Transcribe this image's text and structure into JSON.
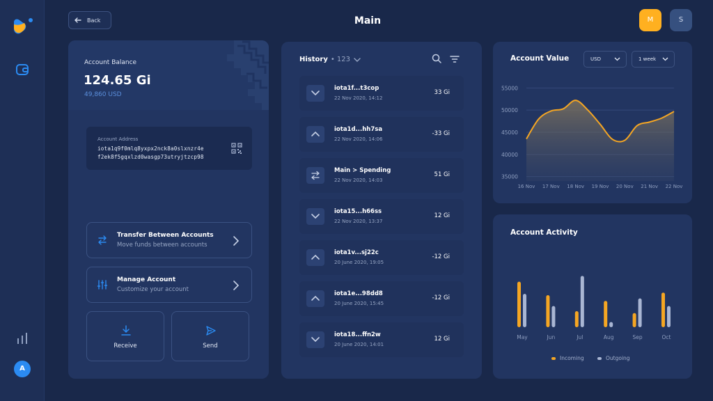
{
  "header": {
    "back_label": "Back",
    "title": "Main",
    "profiles": [
      "M",
      "S"
    ]
  },
  "sidebar": {
    "items": [
      {
        "icon": "wallet-icon"
      },
      {
        "icon": "chart-icon"
      }
    ],
    "avatar": "A"
  },
  "account": {
    "balance_label": "Account Balance",
    "balance": "124.65 Gi",
    "fiat": "49,860 USD",
    "address_label": "Account Address",
    "address_line1": "iota1q9f0mlq8yxpx2nck8a0slxnzr4e",
    "address_line2": "f2ek8f5gqxlzd0wasgp73utryjtzcp98",
    "actions": [
      {
        "title": "Transfer Between Accounts",
        "subtitle": "Move funds between accounts",
        "icon": "transfer-icon"
      },
      {
        "title": "Manage Account",
        "subtitle": "Customize your account",
        "icon": "sliders-icon"
      }
    ],
    "receive_label": "Receive",
    "send_label": "Send"
  },
  "history": {
    "title": "History",
    "count": "• 123",
    "items": [
      {
        "name": "iota1f...t3cop",
        "date": "22 Nov 2020, 14:12",
        "amount": "33 Gi",
        "icon": "chevron-down-icon"
      },
      {
        "name": "iota1d...hh7sa",
        "date": "22 Nov 2020, 14:06",
        "amount": "-33 Gi",
        "icon": "chevron-up-icon"
      },
      {
        "name": "Main > Spending",
        "date": "22 Nov 2020, 14:03",
        "amount": "51 Gi",
        "icon": "transfer-icon"
      },
      {
        "name": "iota15...h66ss",
        "date": "22 Nov 2020, 13:37",
        "amount": "12 Gi",
        "icon": "chevron-down-icon"
      },
      {
        "name": "iota1v...sj22c",
        "date": "20 June 2020, 19:05",
        "amount": "-12 Gi",
        "icon": "chevron-up-icon"
      },
      {
        "name": "iota1e...98dd8",
        "date": "20 June 2020, 15:45",
        "amount": "-12 Gi",
        "icon": "chevron-up-icon"
      },
      {
        "name": "iota18...ffn2w",
        "date": "20 June 2020, 14:01",
        "amount": "12 Gi",
        "icon": "chevron-down-icon"
      }
    ]
  },
  "value": {
    "title": "Account Value",
    "currency": "USD",
    "range": "1 week"
  },
  "activity": {
    "title": "Account Activity",
    "legend_incoming": "Incoming",
    "legend_outgoing": "Outgoing"
  },
  "colors": {
    "accent": "#f5a623",
    "blue": "#2b8bf2",
    "outgoing": "#a9b6d3"
  },
  "chart_data": [
    {
      "type": "area",
      "title": "Account Value",
      "categories": [
        "16 Nov",
        "17 Nov",
        "18 Nov",
        "19 Nov",
        "20 Nov",
        "21 Nov",
        "22 Nov"
      ],
      "x": [
        0,
        0.5,
        1,
        1.5,
        2,
        2.5,
        3,
        3.5,
        4,
        4.5,
        5,
        5.5,
        6
      ],
      "values": [
        43500,
        48000,
        49800,
        50300,
        52200,
        50000,
        46800,
        43400,
        43200,
        46500,
        47300,
        48200,
        49700
      ],
      "yticks": [
        35000,
        40000,
        45000,
        50000,
        55000
      ],
      "ylim": [
        34000,
        56000
      ]
    },
    {
      "type": "bar",
      "title": "Account Activity",
      "categories": [
        "May",
        "Jun",
        "Jul",
        "Aug",
        "Sep",
        "Oct"
      ],
      "series": [
        {
          "name": "Incoming",
          "values": [
            71,
            50,
            25,
            41,
            22,
            54
          ]
        },
        {
          "name": "Outgoing",
          "values": [
            52,
            33,
            80,
            8,
            45,
            33
          ]
        }
      ],
      "ylim": [
        0,
        100
      ]
    }
  ]
}
